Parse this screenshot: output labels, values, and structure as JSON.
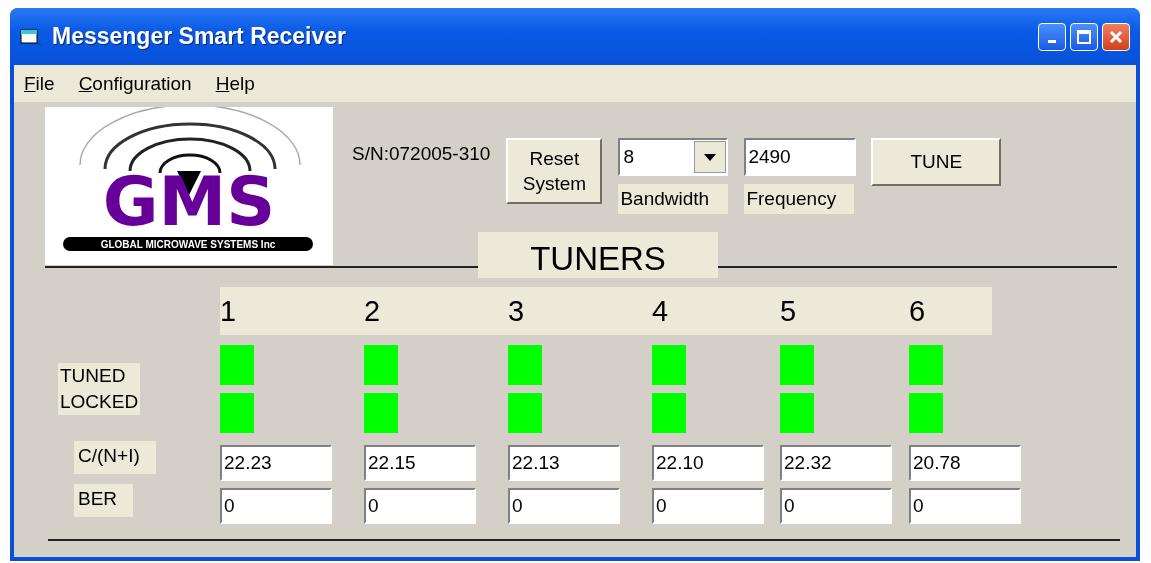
{
  "window": {
    "title": "Messenger Smart Receiver"
  },
  "menu": [
    {
      "label": "File"
    },
    {
      "label": "Configuration"
    },
    {
      "label": "Help"
    }
  ],
  "logo": {
    "wordmark": "GMS",
    "tagline": "GLOBAL MICROWAVE SYSTEMS Inc"
  },
  "serial": "S/N:072005-310",
  "reset_button": "Reset System",
  "bandwidth": {
    "value": "8",
    "label": "Bandwidth"
  },
  "frequency": {
    "value": "2490",
    "label": "Frequency"
  },
  "tune_button": "TUNE",
  "tuners": {
    "title": "TUNERS",
    "labels": {
      "tuned": "TUNED",
      "locked": "LOCKED",
      "cni": "C/(N+I)",
      "ber": "BER"
    },
    "channels": [
      {
        "number": "1",
        "tuned": true,
        "locked": true,
        "cni": "22.23",
        "ber": "0"
      },
      {
        "number": "2",
        "tuned": true,
        "locked": true,
        "cni": "22.15",
        "ber": "0"
      },
      {
        "number": "3",
        "tuned": true,
        "locked": true,
        "cni": "22.13",
        "ber": "0"
      },
      {
        "number": "4",
        "tuned": true,
        "locked": true,
        "cni": "22.10",
        "ber": "0"
      },
      {
        "number": "5",
        "tuned": true,
        "locked": true,
        "cni": "22.32",
        "ber": "0"
      },
      {
        "number": "6",
        "tuned": true,
        "locked": true,
        "cni": "20.78",
        "ber": "0"
      }
    ]
  }
}
